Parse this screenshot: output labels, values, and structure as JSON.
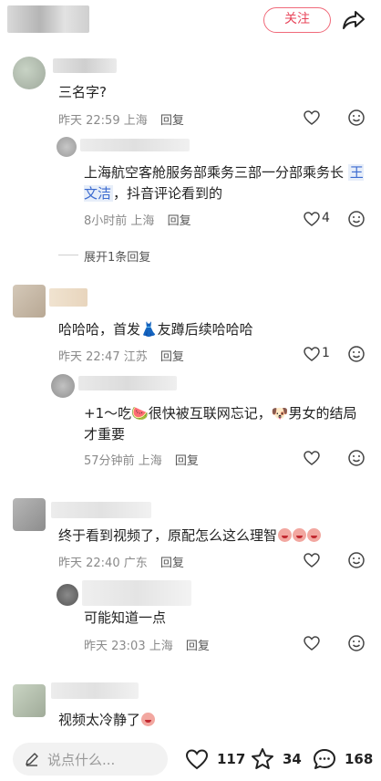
{
  "header": {
    "follow_label": "关注"
  },
  "comments": [
    {
      "text": "三名字?",
      "time": "昨天 22:59",
      "location": "上海",
      "reply_label": "回复",
      "reply": {
        "text_prefix": "上海航空客舱服务部乘务三部一分部乘务长 ",
        "mention": "王文洁",
        "text_suffix": "，抖音评论看到的",
        "time": "8小时前",
        "location": "上海",
        "reply_label": "回复",
        "likes": "4"
      },
      "expand_label": "展开1条回复"
    },
    {
      "text": "哈哈哈，首发👗友蹲后续哈哈哈",
      "time": "昨天 22:47",
      "location": "江苏",
      "reply_label": "回复",
      "likes": "1",
      "reply": {
        "text": "+1～吃🍉很快被互联网忘记，🐶男女的结局才重要",
        "time": "57分钟前",
        "location": "上海",
        "reply_label": "回复"
      }
    },
    {
      "text": "终于看到视频了，原配怎么这么理智",
      "time": "昨天 22:40",
      "location": "广东",
      "reply_label": "回复",
      "reply": {
        "text": "可能知道一点",
        "time": "昨天 23:03",
        "location": "上海",
        "reply_label": "回复"
      }
    },
    {
      "text": "视频太冷静了"
    }
  ],
  "bottom_bar": {
    "input_placeholder": "说点什么...",
    "likes": "117",
    "favorites": "34",
    "comments": "168"
  }
}
